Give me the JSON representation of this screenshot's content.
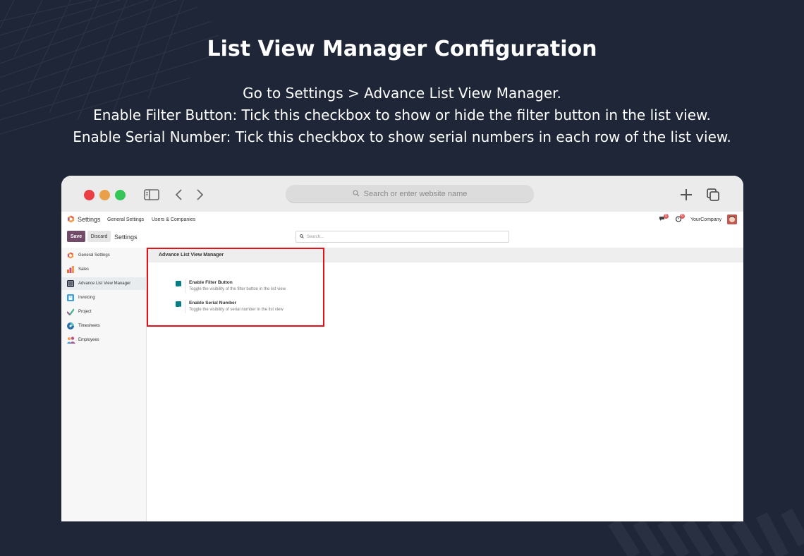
{
  "page": {
    "heading": "List View Manager Configuration",
    "description_lines": [
      "Go to Settings > Advance List View Manager.",
      "Enable Filter Button: Tick this checkbox to show or hide the filter button in the list view.",
      "Enable Serial Number: Tick this checkbox to show serial numbers in each row of the list view."
    ]
  },
  "browser": {
    "url_placeholder": "Search or enter website name",
    "icons": [
      "sidebar-toggle-icon",
      "back-icon",
      "forward-icon",
      "new-tab-icon",
      "tabs-overview-icon",
      "search-icon"
    ]
  },
  "navbar": {
    "app_name": "Settings",
    "menu": [
      "General Settings",
      "Users & Companies"
    ],
    "messages_count": "5",
    "activities_count": "6",
    "company": "YourCompany"
  },
  "control": {
    "save_label": "Save",
    "discard_label": "Discard",
    "breadcrumb": "Settings",
    "search_placeholder": "Search..."
  },
  "sidebar": {
    "items": [
      {
        "label": "General Settings",
        "icon": "odoo-logo-icon",
        "color": "#f29b4c"
      },
      {
        "label": "Sales",
        "icon": "sales-chart-icon",
        "color": "#e8752f"
      },
      {
        "label": "Advance List View Manager",
        "icon": "list-view-manager-icon",
        "color": "#1f2637"
      },
      {
        "label": "Invoicing",
        "icon": "invoicing-icon",
        "color": "#3b9fd8"
      },
      {
        "label": "Project",
        "icon": "project-check-icon",
        "color": "#3db387"
      },
      {
        "label": "Timesheets",
        "icon": "timesheets-icon",
        "color": "#2b6fa8"
      },
      {
        "label": "Employees",
        "icon": "employees-icon",
        "color": "#c94c7e"
      }
    ],
    "active_index": 2
  },
  "section": {
    "title": "Advance List View Manager",
    "settings": [
      {
        "label": "Enable Filter Button",
        "help": "Toggle the visibility of the filter button in the list view",
        "checked": true
      },
      {
        "label": "Enable Serial Number",
        "help": "Toggle the visibility of serial number in the list view",
        "checked": true
      }
    ]
  },
  "colors": {
    "background": "#1f2637",
    "primary_button": "#714b67",
    "checkbox": "#017e84",
    "highlight": "#e3121a"
  }
}
